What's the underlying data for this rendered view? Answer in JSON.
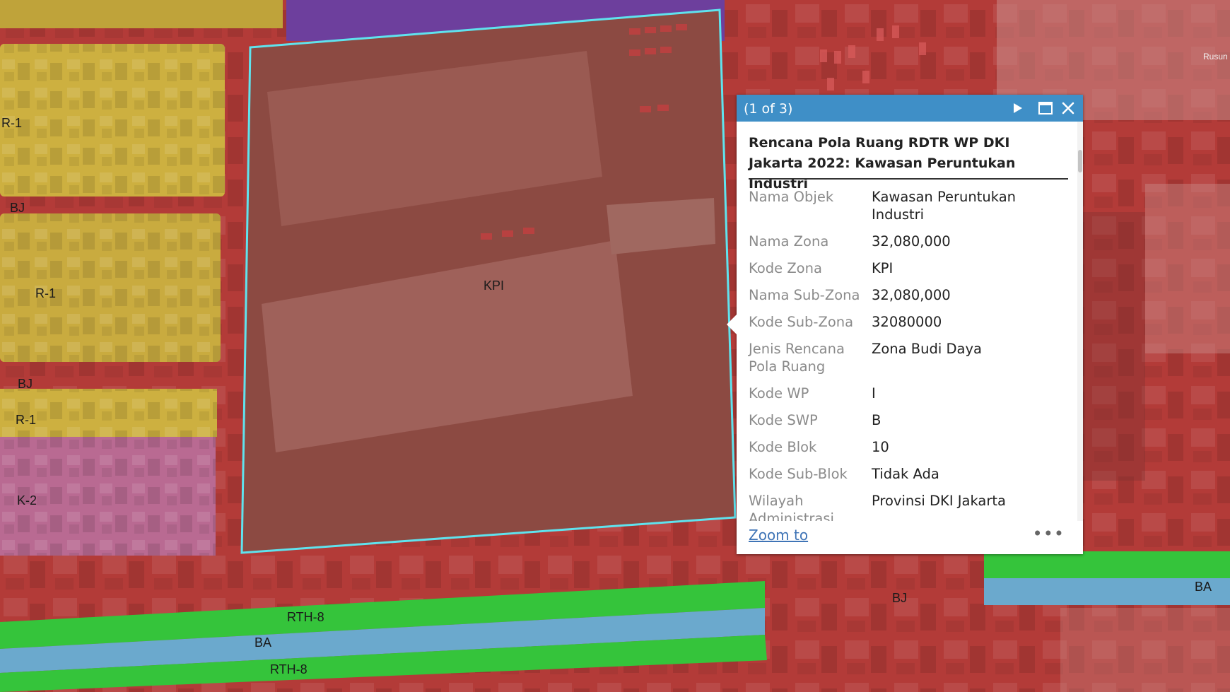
{
  "map": {
    "zone_labels": [
      "R-1",
      "BJ",
      "R-1",
      "BJ",
      "R-1",
      "K-2",
      "KPI",
      "RTH-8",
      "BA",
      "RTH-8",
      "BJ",
      "BA"
    ],
    "edge_text": "Rusun",
    "colors": {
      "industri": "#b23a37",
      "residential": "#cdb040",
      "commercial": "#b96a92",
      "purple": "#6e3fa0",
      "rth": "#35c43b",
      "water": "#6ba9cd",
      "highlight": "#5fe3ee"
    }
  },
  "popup": {
    "count": "(1 of 3)",
    "title": "Rencana Pola Ruang RDTR WP DKI Jakarta 2022: Kawasan Peruntukan Industri",
    "rows": [
      {
        "key": "Nama Objek",
        "value": "Kawasan Peruntukan Industri"
      },
      {
        "key": "Nama Zona",
        "value": "32,080,000"
      },
      {
        "key": "Kode Zona",
        "value": "KPI"
      },
      {
        "key": "Nama Sub-Zona",
        "value": "32,080,000"
      },
      {
        "key": "Kode Sub-Zona",
        "value": "32080000"
      },
      {
        "key": "Jenis Rencana Pola Ruang",
        "value": "Zona Budi Daya"
      },
      {
        "key": "Kode WP",
        "value": "I"
      },
      {
        "key": "Kode SWP",
        "value": "B"
      },
      {
        "key": "Kode Blok",
        "value": "10"
      },
      {
        "key": "Kode Sub-Blok",
        "value": "Tidak Ada"
      },
      {
        "key": "Wilayah Administrasi",
        "value": "Provinsi DKI Jakarta"
      }
    ],
    "zoom_label": "Zoom to",
    "more_label": "•••",
    "header_color": "#3f8fc7"
  }
}
